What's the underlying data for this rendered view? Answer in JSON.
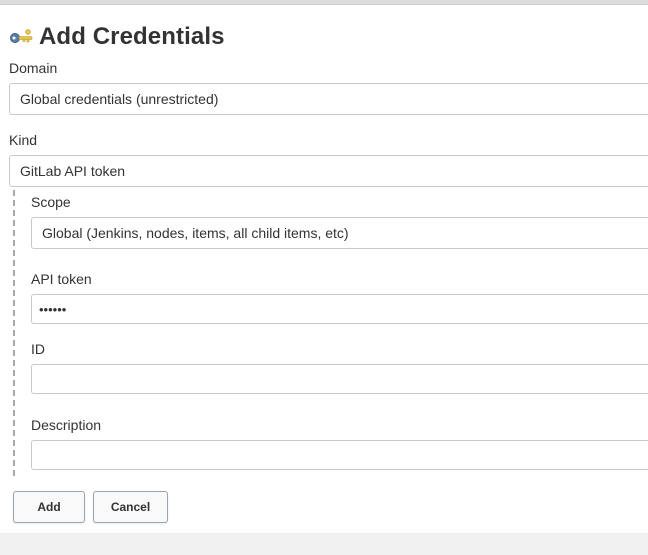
{
  "page": {
    "title": "Add Credentials",
    "title_icon": "key-icon"
  },
  "form": {
    "domain": {
      "label": "Domain",
      "value": "Global credentials (unrestricted)"
    },
    "kind": {
      "label": "Kind",
      "value": "GitLab API token"
    },
    "scope": {
      "label": "Scope",
      "value": "Global (Jenkins, nodes, items, all child items, etc)"
    },
    "api_token": {
      "label": "API token",
      "value": "••••••"
    },
    "id": {
      "label": "ID",
      "value": ""
    },
    "description": {
      "label": "Description",
      "value": ""
    }
  },
  "buttons": {
    "add_label": "Add",
    "cancel_label": "Cancel"
  },
  "colors": {
    "border": "#c9c9c9",
    "text": "#333333",
    "button_border": "#9aa4ad"
  }
}
